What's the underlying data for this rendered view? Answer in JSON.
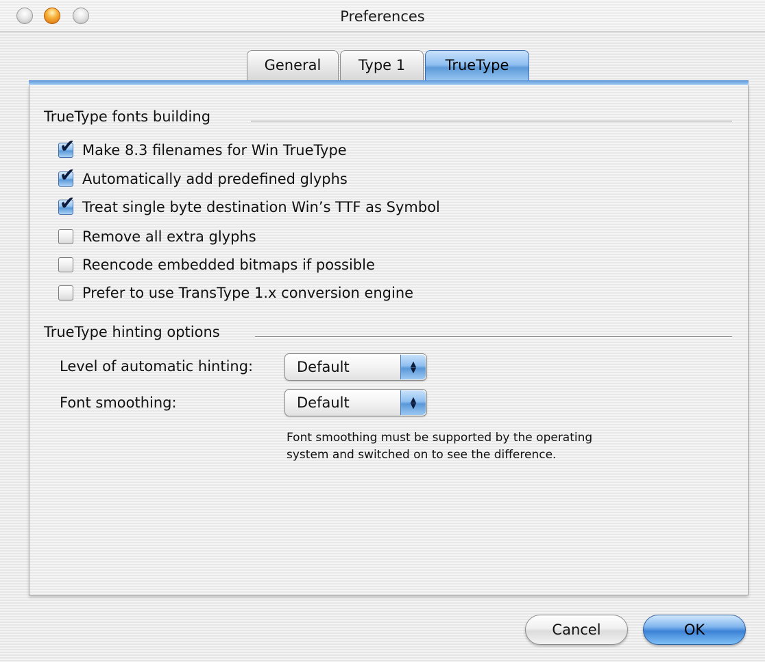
{
  "window": {
    "title": "Preferences"
  },
  "tabs": [
    {
      "label": "General",
      "selected": false
    },
    {
      "label": "Type 1",
      "selected": false
    },
    {
      "label": "TrueType",
      "selected": true
    }
  ],
  "sections": {
    "building": {
      "title": "TrueType fonts building",
      "options": [
        {
          "label": "Make 8.3 filenames for Win TrueType",
          "checked": true
        },
        {
          "label": "Automatically add predefined glyphs",
          "checked": true
        },
        {
          "label": "Treat single byte destination Win’s TTF as Symbol",
          "checked": true
        },
        {
          "label": "Remove all extra glyphs",
          "checked": false
        },
        {
          "label": "Reencode embedded bitmaps if possible",
          "checked": false
        },
        {
          "label": "Prefer to use TransType 1.x conversion engine",
          "checked": false
        }
      ]
    },
    "hinting": {
      "title": "TrueType hinting options",
      "level_label": "Level of automatic hinting:",
      "level_value": "Default",
      "smoothing_label": "Font smoothing:",
      "smoothing_value": "Default",
      "note_line1": "Font smoothing must be supported by the operating",
      "note_line2": "system and switched on to see the difference."
    }
  },
  "buttons": {
    "cancel": "Cancel",
    "ok": "OK"
  },
  "icons": {
    "check": "✔",
    "popup_up": "▲",
    "popup_down": "▼"
  },
  "colors": {
    "accent": "#5e9bd9",
    "close_button": "#e6e6e6",
    "minimize_button": "#f7b23a"
  }
}
